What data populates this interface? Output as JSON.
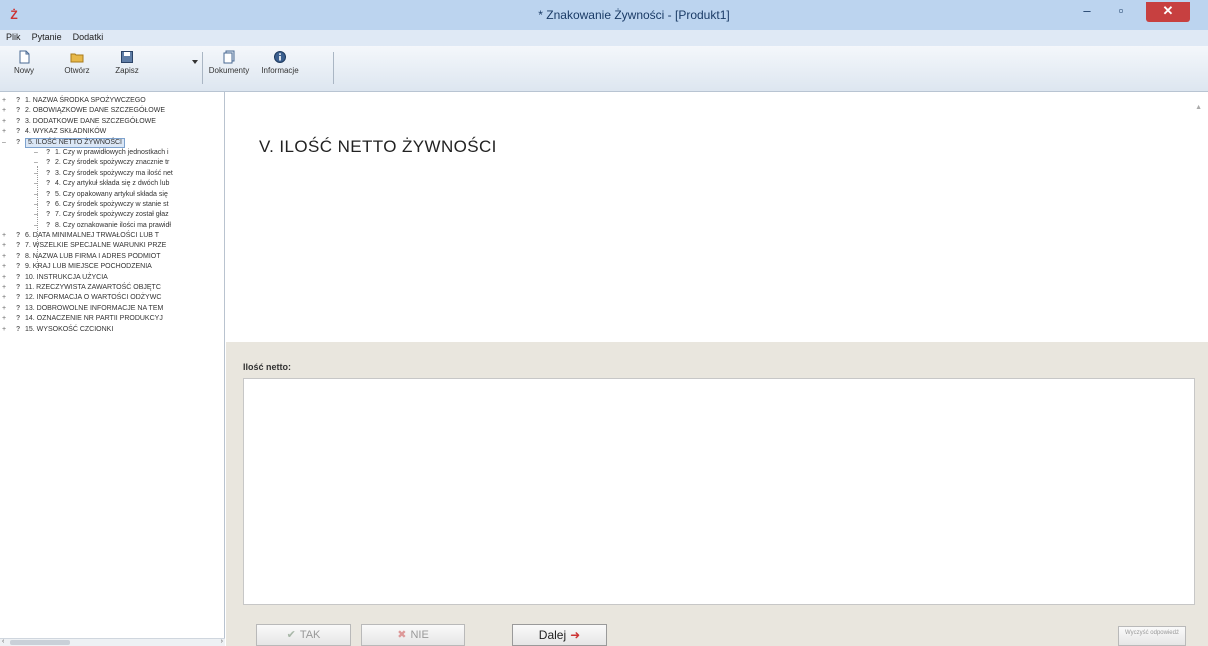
{
  "window": {
    "title": "* Znakowanie Żywności - [Produkt1]",
    "app_icon": "Ż",
    "minimize": "–",
    "maximize": "▫",
    "close": "✕"
  },
  "menu": [
    "Plik",
    "Pytanie",
    "Dodatki"
  ],
  "toolbar": {
    "new": "Nowy",
    "open": "Otwórz",
    "save": "Zapisz",
    "documents": "Dokumenty",
    "info": "Informacje"
  },
  "tree": {
    "items": [
      {
        "exp": "+",
        "q": "?",
        "label": "1. NAZWA ŚRODKA SPOŻYWCZEGO"
      },
      {
        "exp": "+",
        "q": "?",
        "label": "2. OBOWIĄZKOWE DANE SZCZEGÓŁOWE"
      },
      {
        "exp": "+",
        "q": "?",
        "label": "3. DODATKOWE DANE SZCZEGÓŁOWE"
      },
      {
        "exp": "+",
        "q": "?",
        "label": "4. WYKAZ SKŁADNIKÓW"
      },
      {
        "exp": "–",
        "q": "?",
        "label": "5. ILOŚĆ NETTO ŻYWNOŚCI",
        "selected": true
      },
      {
        "q": "?",
        "label": "1. Czy w prawidłowych jednostkach i",
        "child": true
      },
      {
        "q": "?",
        "label": "2. Czy środek spożywczy znacznie tr",
        "child": true
      },
      {
        "q": "?",
        "label": "3. Czy środek spożywczy ma ilość net",
        "child": true
      },
      {
        "q": "?",
        "label": "4. Czy artykuł składa się z dwóch lub",
        "child": true
      },
      {
        "q": "?",
        "label": "5. Czy opakowany artykuł składa się",
        "child": true
      },
      {
        "q": "?",
        "label": "6. Czy środek spożywczy w stanie st",
        "child": true
      },
      {
        "q": "?",
        "label": "7. Czy środek spożywczy został głaz",
        "child": true
      },
      {
        "q": "?",
        "label": "8. Czy oznakowanie ilości ma prawidł",
        "child": true
      },
      {
        "exp": "+",
        "q": "?",
        "label": "6. DATA MINIMALNEJ TRWAŁOŚCI LUB T"
      },
      {
        "exp": "+",
        "q": "?",
        "label": "7. WSZELKIE SPECJALNE WARUNKI PRZE"
      },
      {
        "exp": "+",
        "q": "?",
        "label": "8. NAZWA LUB FIRMA I ADRES PODMIOT"
      },
      {
        "exp": "+",
        "q": "?",
        "label": "9. KRAJ LUB MIEJSCE POCHODZENIA"
      },
      {
        "exp": "+",
        "q": "?",
        "label": "10. INSTRUKCJA UŻYCIA"
      },
      {
        "exp": "+",
        "q": "?",
        "label": "11. RZECZYWISTA ZAWARTOŚĆ OBJĘTC"
      },
      {
        "exp": "+",
        "q": "?",
        "label": "12. INFORMACJA O WARTOŚCI ODŻYWC"
      },
      {
        "exp": "+",
        "q": "?",
        "label": "13. DOBROWOLNE INFORMACJE NA TEM"
      },
      {
        "exp": "+",
        "q": "?",
        "label": "14. OZNACZENIE NR PARTII PRODUKCYJ"
      },
      {
        "exp": "+",
        "q": "?",
        "label": "15. WYSOKOŚĆ CZCIONKI"
      }
    ]
  },
  "main": {
    "section_title": "V. ILOŚĆ NETTO ŻYWNOŚCI",
    "field_label": "Ilość netto:",
    "answer_value": ""
  },
  "buttons": {
    "yes": "TAK",
    "no": "NIE",
    "next": "Dalej",
    "corner": "Wyczyść odpowiedź"
  },
  "colors": {
    "titlebar": "#bcd4ef",
    "close": "#c74040",
    "selected": "#dbe7f6",
    "panel": "#e9e6de"
  }
}
